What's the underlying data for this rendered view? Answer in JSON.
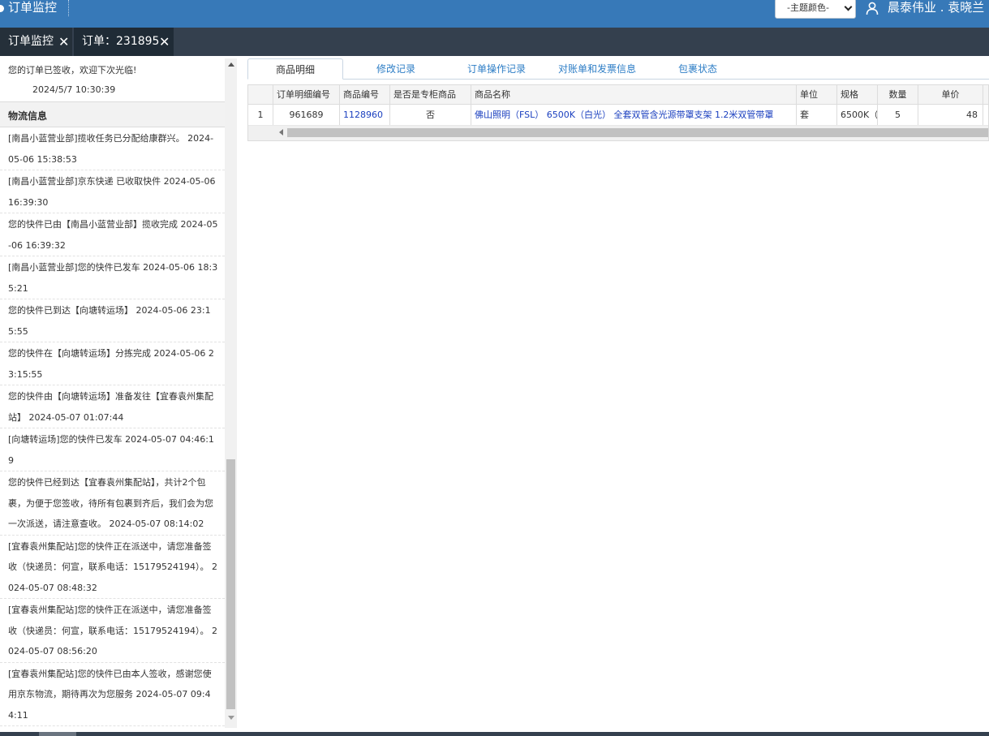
{
  "header": {
    "title": "订单监控",
    "theme_select": "-主题颜色-",
    "user_name": "晨泰伟业 . 袁晓兰"
  },
  "tabs": [
    {
      "label": "订单监控",
      "close": "✕"
    },
    {
      "label": "订单：231895",
      "close": "✕"
    }
  ],
  "left": {
    "signed_message": "您的订单已签收，欢迎下次光临!",
    "signed_time": "2024/5/7 10:30:39",
    "section_title": "物流信息",
    "logs": [
      "[南昌小蓝营业部]揽收任务已分配给康群兴。 2024-05-06 15:38:53",
      "[南昌小蓝营业部]京东快递 已收取快件 2024-05-06 16:39:30",
      "您的快件已由【南昌小蓝营业部】揽收完成 2024-05-06 16:39:32",
      "[南昌小蓝营业部]您的快件已发车 2024-05-06 18:35:21",
      "您的快件已到达【向塘转运场】 2024-05-06 23:15:55",
      "您的快件在【向塘转运场】分拣完成 2024-05-06 23:15:55",
      "您的快件由【向塘转运场】准备发往【宜春袁州集配站】 2024-05-07 01:07:44",
      "[向塘转运场]您的快件已发车 2024-05-07 04:46:19",
      "您的快件已经到达【宜春袁州集配站】，共计2个包裹，为便于您签收，待所有包裹到齐后，我们会为您一次派送，请注意查收。 2024-05-07 08:14:02",
      "[宜春袁州集配站]您的快件正在派送中，请您准备签收（快递员：何宣，联系电话：15179524194）。 2024-05-07 08:48:32",
      "[宜春袁州集配站]您的快件正在派送中，请您准备签收（快递员：何宣，联系电话：15179524194）。 2024-05-07 08:56:20",
      "[宜春袁州集配站]您的快件已由本人签收，感谢您使用京东物流，期待再次为您服务 2024-05-07 09:44:11"
    ]
  },
  "right": {
    "tabs": [
      "商品明细",
      "修改记录",
      "订单操作记录",
      "对账单和发票信息",
      "包裹状态"
    ],
    "table": {
      "headers": [
        "订单明细编号",
        "商品编号",
        "是否是专柜商品",
        "商品名称",
        "单位",
        "规格",
        "数量",
        "单价"
      ],
      "rows": [
        {
          "rownum": "1",
          "detail_id": "961689",
          "product_id": "1128960",
          "is_counter": "否",
          "name": "佛山照明（FSL） 6500K（白光） 全套双管含光源带罩支架 1.2米双管带罩",
          "unit": "套",
          "spec": "6500K（",
          "qty": "5",
          "price": "48"
        }
      ]
    }
  }
}
